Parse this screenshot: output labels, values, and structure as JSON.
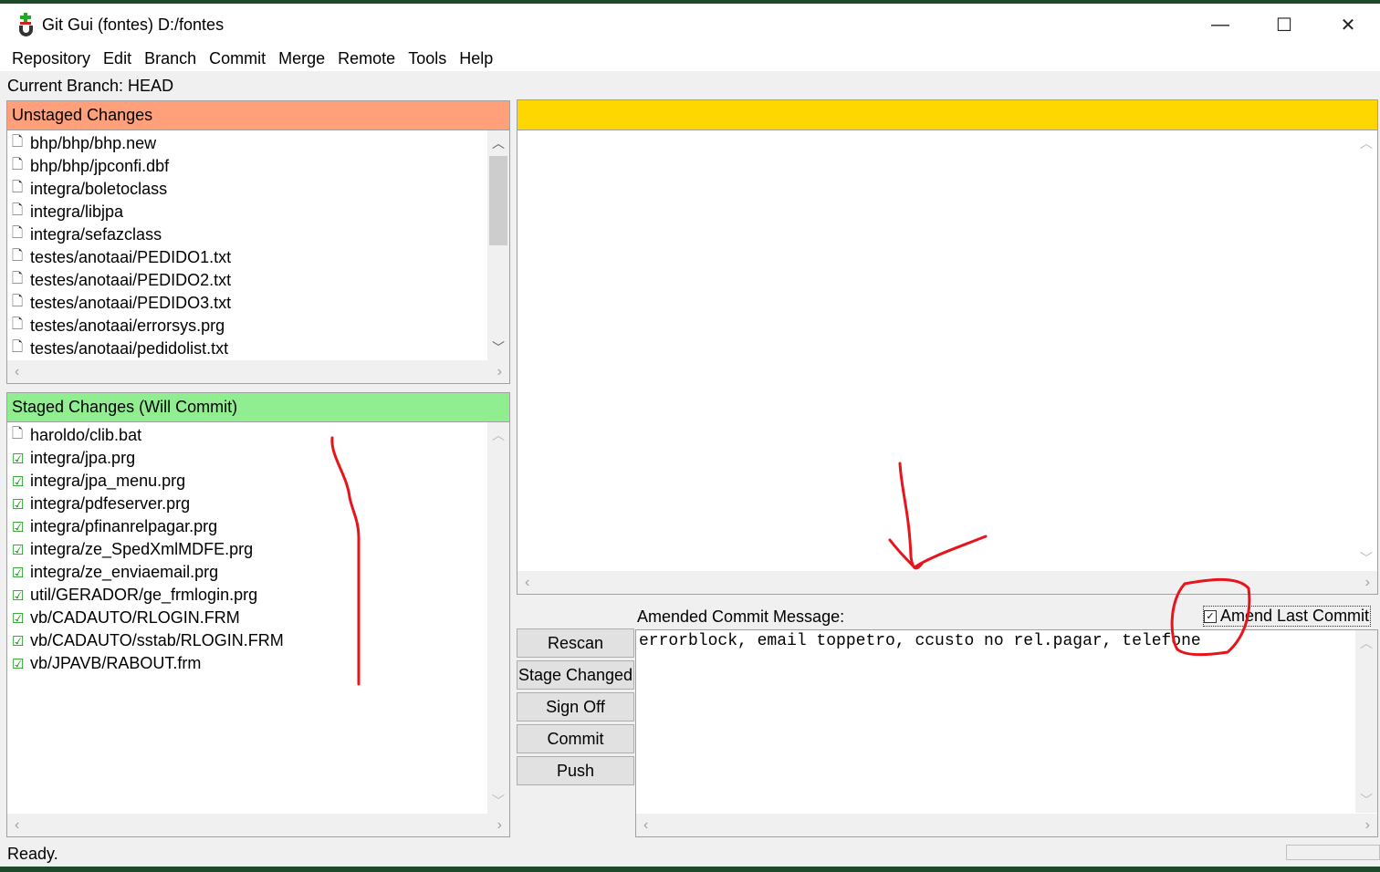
{
  "window": {
    "title": "Git Gui (fontes) D:/fontes",
    "minimize": "—",
    "maximize": "☐",
    "close": "✕"
  },
  "menu": [
    "Repository",
    "Edit",
    "Branch",
    "Commit",
    "Merge",
    "Remote",
    "Tools",
    "Help"
  ],
  "branch": "Current Branch: HEAD",
  "unstaged": {
    "title": "Unstaged Changes",
    "files": [
      "bhp/bhp/bhp.new",
      "bhp/bhp/jpconfi.dbf",
      "integra/boletoclass",
      "integra/libjpa",
      "integra/sefazclass",
      "testes/anotaai/PEDIDO1.txt",
      "testes/anotaai/PEDIDO2.txt",
      "testes/anotaai/PEDIDO3.txt",
      "testes/anotaai/errorsys.prg",
      "testes/anotaai/pedidolist.txt"
    ]
  },
  "staged": {
    "title": "Staged Changes (Will Commit)",
    "files": [
      {
        "name": "haroldo/clib.bat",
        "checked": false
      },
      {
        "name": "integra/jpa.prg",
        "checked": true
      },
      {
        "name": "integra/jpa_menu.prg",
        "checked": true
      },
      {
        "name": "integra/pdfeserver.prg",
        "checked": true
      },
      {
        "name": "integra/pfinanrelpagar.prg",
        "checked": true
      },
      {
        "name": "integra/ze_SpedXmlMDFE.prg",
        "checked": true
      },
      {
        "name": "integra/ze_enviaemail.prg",
        "checked": true
      },
      {
        "name": "util/GERADOR/ge_frmlogin.prg",
        "checked": true
      },
      {
        "name": "vb/CADAUTO/RLOGIN.FRM",
        "checked": true
      },
      {
        "name": "vb/CADAUTO/sstab/RLOGIN.FRM",
        "checked": true
      },
      {
        "name": "vb/JPAVB/RABOUT.frm",
        "checked": true
      }
    ]
  },
  "commit": {
    "label": "Amended Commit Message:",
    "amend_label": "Amend Last Commit",
    "amend_checked": true,
    "message": "errorblock, email toppetro, ccusto no rel.pagar, telefone"
  },
  "buttons": {
    "rescan": "Rescan",
    "stage": "Stage Changed",
    "signoff": "Sign Off",
    "commit": "Commit",
    "push": "Push"
  },
  "status": "Ready.",
  "colors": {
    "unstaged": "#ffa07a",
    "staged": "#90ee90",
    "diff_header": "#ffd700",
    "annotation": "#e8141c"
  }
}
